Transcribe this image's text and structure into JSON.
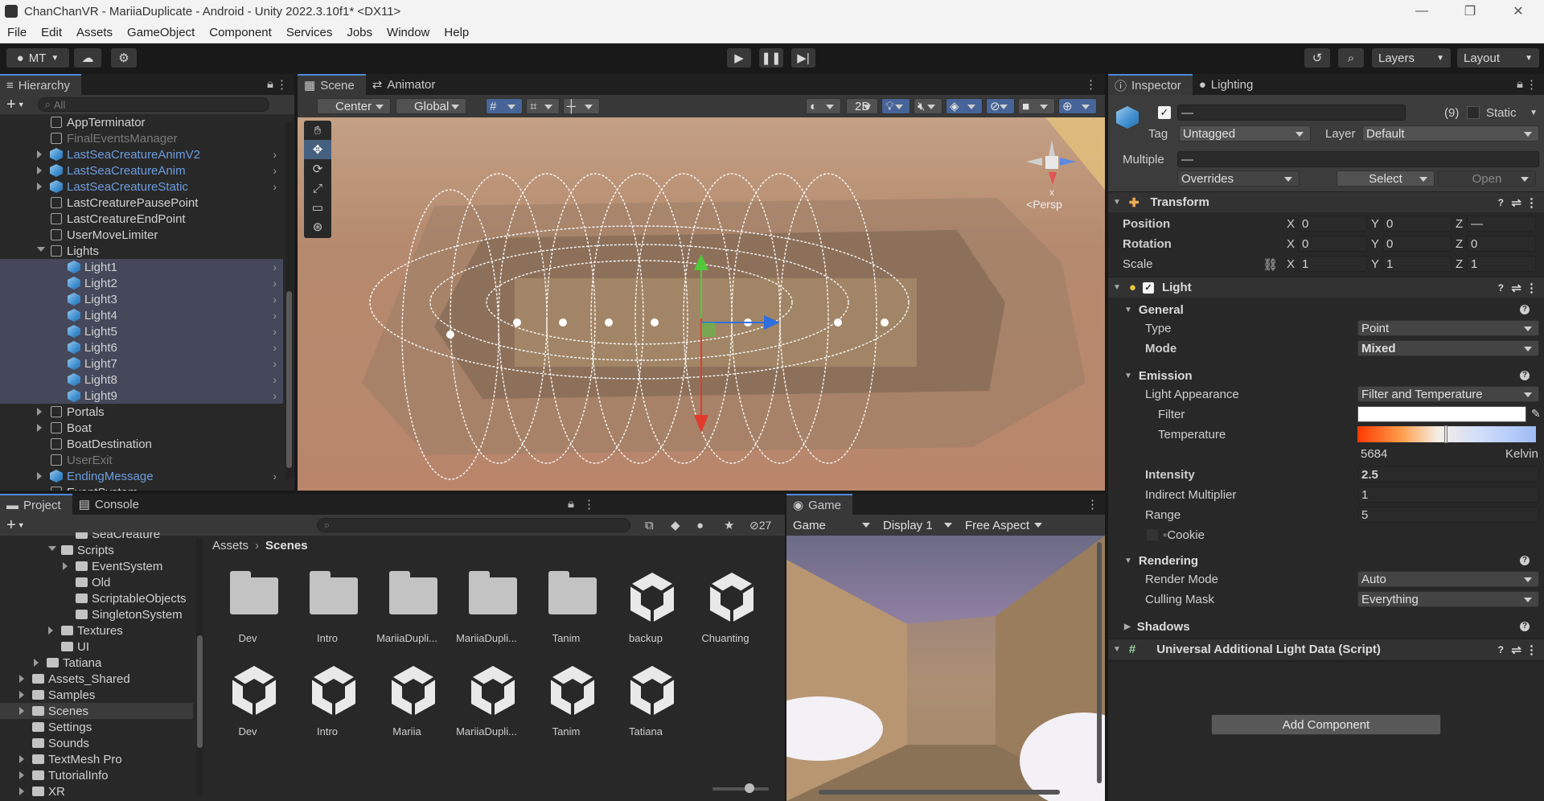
{
  "window": {
    "title": "ChanChanVR - MariiaDuplicate - Android - Unity 2022.3.10f1* <DX11>",
    "minimize": "—",
    "restore": "❐",
    "close": "✕"
  },
  "menu": [
    "File",
    "Edit",
    "Assets",
    "GameObject",
    "Component",
    "Services",
    "Jobs",
    "Window",
    "Help"
  ],
  "toolbar": {
    "account": "MT",
    "layers": "Layers",
    "layout": "Layout"
  },
  "hierarchy": {
    "tab": "Hierarchy",
    "search_placeholder": "All",
    "items": [
      {
        "label": "AppTerminator",
        "state": "normal",
        "indent": 1
      },
      {
        "label": "FinalEventsManager",
        "state": "dim",
        "indent": 1
      },
      {
        "label": "LastSeaCreatureAnimV2",
        "state": "blue",
        "indent": 1,
        "expand": true,
        "chevron": true
      },
      {
        "label": "LastSeaCreatureAnim",
        "state": "blue",
        "indent": 1,
        "expand": true,
        "chevron": true
      },
      {
        "label": "LastSeaCreatureStatic",
        "state": "blue",
        "indent": 1,
        "expand": true,
        "chevron": true
      },
      {
        "label": "LastCreaturePausePoint",
        "state": "normal",
        "indent": 1
      },
      {
        "label": "LastCreatureEndPoint",
        "state": "normal",
        "indent": 1
      },
      {
        "label": "UserMoveLimiter",
        "state": "normal",
        "indent": 1
      },
      {
        "label": "Lights",
        "state": "normal",
        "indent": 1,
        "open": true
      },
      {
        "label": "Light1",
        "state": "sel",
        "indent": 2,
        "chevron": true
      },
      {
        "label": "Light2",
        "state": "sel",
        "indent": 2,
        "chevron": true
      },
      {
        "label": "Light3",
        "state": "sel",
        "indent": 2,
        "chevron": true
      },
      {
        "label": "Light4",
        "state": "sel",
        "indent": 2,
        "chevron": true
      },
      {
        "label": "Light5",
        "state": "sel",
        "indent": 2,
        "chevron": true
      },
      {
        "label": "Light6",
        "state": "sel",
        "indent": 2,
        "chevron": true
      },
      {
        "label": "Light7",
        "state": "sel",
        "indent": 2,
        "chevron": true
      },
      {
        "label": "Light8",
        "state": "sel",
        "indent": 2,
        "chevron": true
      },
      {
        "label": "Light9",
        "state": "sel",
        "indent": 2,
        "chevron": true
      },
      {
        "label": "Portals",
        "state": "normal",
        "indent": 1,
        "expand": true
      },
      {
        "label": "Boat",
        "state": "normal",
        "indent": 1,
        "expand": true
      },
      {
        "label": "BoatDestination",
        "state": "normal",
        "indent": 1
      },
      {
        "label": "UserExit",
        "state": "dim",
        "indent": 1
      },
      {
        "label": "EndingMessage",
        "state": "blue",
        "indent": 1,
        "expand": true,
        "chevron": true
      },
      {
        "label": "EventSystem",
        "state": "normal",
        "indent": 1
      }
    ]
  },
  "scene": {
    "tabs": [
      "Scene",
      "Animator"
    ],
    "pivot": "Center",
    "space": "Global",
    "mode_2d": "2D",
    "persp": "Persp",
    "gizmo_axis": "x"
  },
  "project": {
    "tabs": [
      "Project",
      "Console"
    ],
    "hidden_count": "27",
    "breadcrumb": [
      "Assets",
      "Scenes"
    ],
    "tree": [
      {
        "label": "SeaCreature",
        "indent": 3
      },
      {
        "label": "Scripts",
        "indent": 2,
        "open": true
      },
      {
        "label": "EventSystem",
        "indent": 3,
        "expand": true
      },
      {
        "label": "Old",
        "indent": 3
      },
      {
        "label": "ScriptableObjects",
        "indent": 3
      },
      {
        "label": "SingletonSystem",
        "indent": 3
      },
      {
        "label": "Textures",
        "indent": 2,
        "expand": true
      },
      {
        "label": "UI",
        "indent": 2
      },
      {
        "label": "Tatiana",
        "indent": 1,
        "expand": true
      },
      {
        "label": "Assets_Shared",
        "indent": 0,
        "expand": true
      },
      {
        "label": "Samples",
        "indent": 0,
        "expand": true
      },
      {
        "label": "Scenes",
        "indent": 0,
        "expand": true,
        "sel": true
      },
      {
        "label": "Settings",
        "indent": 0
      },
      {
        "label": "Sounds",
        "indent": 0
      },
      {
        "label": "TextMesh Pro",
        "indent": 0,
        "expand": true
      },
      {
        "label": "TutorialInfo",
        "indent": 0,
        "expand": true
      },
      {
        "label": "XR",
        "indent": 0,
        "expand": true
      }
    ],
    "assets": [
      {
        "name": "Dev",
        "kind": "folder"
      },
      {
        "name": "Intro",
        "kind": "folder"
      },
      {
        "name": "MariiaDupli...",
        "kind": "folder"
      },
      {
        "name": "MariiaDupli...",
        "kind": "folder"
      },
      {
        "name": "Tanim",
        "kind": "folder"
      },
      {
        "name": "backup",
        "kind": "scene"
      },
      {
        "name": "Chuanting",
        "kind": "scene"
      },
      {
        "name": "Dev",
        "kind": "scene"
      },
      {
        "name": "Intro",
        "kind": "scene"
      },
      {
        "name": "Mariia",
        "kind": "scene"
      },
      {
        "name": "MariiaDupli...",
        "kind": "scene"
      },
      {
        "name": "Tanim",
        "kind": "scene"
      },
      {
        "name": "Tatiana",
        "kind": "scene"
      }
    ]
  },
  "game": {
    "tab": "Game",
    "view": "Game",
    "display": "Display 1",
    "aspect": "Free Aspect"
  },
  "inspector": {
    "tabs": [
      "Inspector",
      "Lighting"
    ],
    "object_name": "—",
    "count": "(9)",
    "static_label": "Static",
    "tag_label": "Tag",
    "tag": "Untagged",
    "layer_label": "Layer",
    "layer": "Default",
    "multiple_label": "Multiple",
    "multiple_value": "—",
    "overrides": "Overrides",
    "select": "Select",
    "open": "Open",
    "transform": {
      "title": "Transform",
      "position_label": "Position",
      "position": [
        "0",
        "0",
        "—"
      ],
      "rotation_label": "Rotation",
      "rotation": [
        "0",
        "0",
        "0"
      ],
      "scale_label": "Scale",
      "scale": [
        "1",
        "1",
        "1"
      ]
    },
    "light": {
      "title": "Light",
      "general": "General",
      "type_label": "Type",
      "type": "Point",
      "mode_label": "Mode",
      "mode": "Mixed",
      "emission": "Emission",
      "appearance_label": "Light Appearance",
      "appearance": "Filter and Temperature",
      "filter_label": "Filter",
      "temperature_label": "Temperature",
      "temperature_value": "5684",
      "kelvin": "Kelvin",
      "intensity_label": "Intensity",
      "intensity": "2.5",
      "indirect_label": "Indirect Multiplier",
      "indirect": "1",
      "range_label": "Range",
      "range": "5",
      "cookie_label": "Cookie",
      "rendering": "Rendering",
      "render_mode_label": "Render Mode",
      "render_mode": "Auto",
      "culling_label": "Culling Mask",
      "culling": "Everything",
      "shadows": "Shadows"
    },
    "urp": "Universal Additional Light Data (Script)",
    "add_component": "Add Component"
  },
  "axis_labels": [
    "X",
    "Y",
    "Z"
  ],
  "colors": {
    "accent": "#4f8ad8",
    "selection": "#44485a",
    "prefab_blue": "#6c9de0"
  }
}
